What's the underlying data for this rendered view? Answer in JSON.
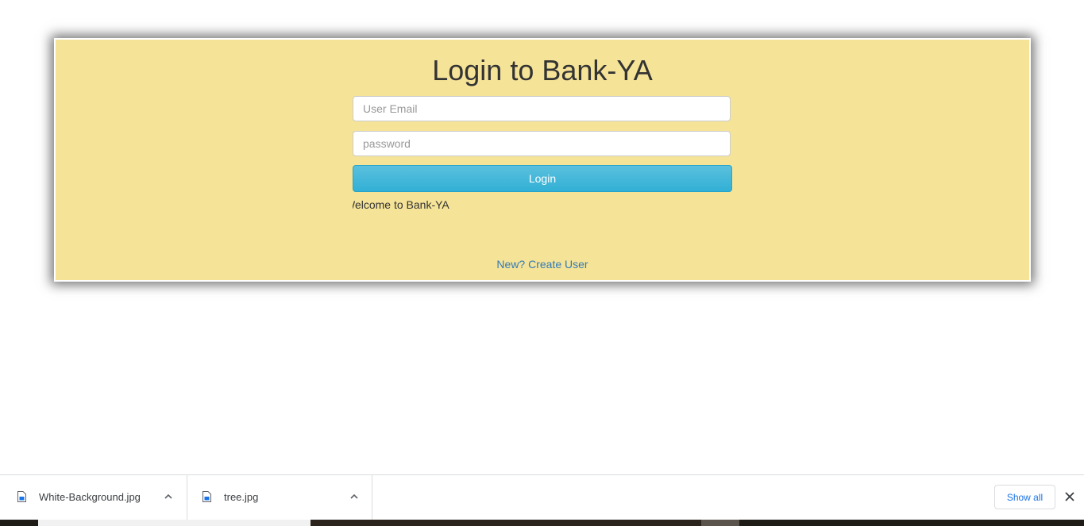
{
  "login": {
    "title": "Login to Bank-YA",
    "email_placeholder": "User Email",
    "password_placeholder": "password",
    "login_button_label": "Login",
    "marquee_text": "Welcome to Bank-YA",
    "create_user_link": "New? Create User"
  },
  "colors": {
    "panel_background": "#f5e397",
    "button_accent": "#31b0d5",
    "link": "#337ab7"
  },
  "downloads": {
    "items": [
      {
        "file_name": "White-Background.jpg",
        "icon": "image-file-icon"
      },
      {
        "file_name": "tree.jpg",
        "icon": "image-file-icon"
      }
    ],
    "show_all_label": "Show all"
  }
}
